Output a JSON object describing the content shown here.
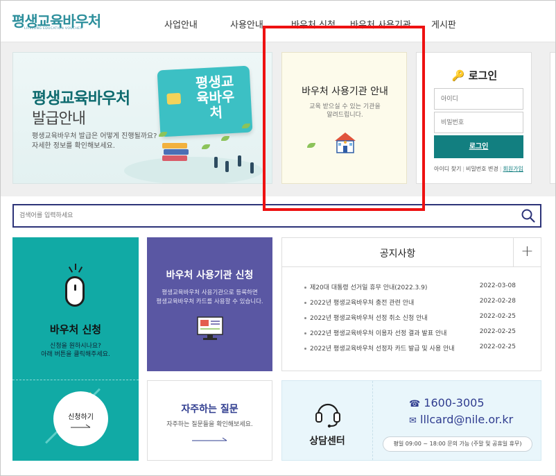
{
  "logo": {
    "main": "평생교육바우처",
    "sub": "LIFELONG EDUCATION VOUCHER"
  },
  "nav": [
    "사업안내",
    "사용안내",
    "바우처 신청",
    "바우처 사용기관",
    "게시판"
  ],
  "banner": {
    "card_text": "평생교육바우처",
    "title": "평생교육바우처",
    "subtitle": "발급안내",
    "desc1": "평생교육바우처 발급은 어떻게 진행될까요?",
    "desc2": "자세한 정보를 확인해보세요."
  },
  "voucher_panel": {
    "title": "바우처 사용기관 안내",
    "desc1": "교육 받으실 수 있는 기관을",
    "desc2": "알려드립니다."
  },
  "login": {
    "title": "로그인",
    "id_placeholder": "아이디",
    "pw_placeholder": "비밀번호",
    "button": "로그인",
    "find_id": "아이디 찾기",
    "change_pw": "비밀번호 변경",
    "join": "회원가입"
  },
  "search": {
    "placeholder": "검색어를 입력하세요"
  },
  "apply_tile": {
    "title": "바우처 신청",
    "desc1": "신청을 원하시나요?",
    "desc2": "아래 버튼을 클릭해주세요.",
    "button": "신청하기"
  },
  "institution_tile": {
    "title": "바우처 사용기관 신청",
    "desc1": "평생교육바우처 사용기관으로 등록하면",
    "desc2": "평생교육바우처 카드를 사용할 수 있습니다."
  },
  "faq": {
    "title": "자주하는 질문",
    "desc": "자주하는 질문들을 확인해보세요."
  },
  "notice": {
    "title": "공지사항",
    "more": "+",
    "items": [
      {
        "title": "제20대 대통령 선거일 휴무 안내(2022.3.9)",
        "date": "2022-03-08"
      },
      {
        "title": "2022년 평생교육바우처 충전 관련 안내",
        "date": "2022-02-28"
      },
      {
        "title": "2022년 평생교육바우처 선정 취소 신청 안내",
        "date": "2022-02-25"
      },
      {
        "title": "2022년 평생교육바우처 이용자 선정 결과 발표 안내",
        "date": "2022-02-25"
      },
      {
        "title": "2022년 평생교육바우처 선정자 카드 발급 및 사용 안내",
        "date": "2022-02-25"
      }
    ]
  },
  "center": {
    "title": "상담센터",
    "phone": "1600-3005",
    "email": "lllcard@nile.or.kr",
    "hours": "평일 09:00 ~ 18:00 문의 가능 (주말 및 공휴일 휴무)"
  },
  "colors": {
    "teal": "#11aaa5",
    "dark_teal": "#127f80",
    "purple": "#5a57a3",
    "navy": "#2f3c8f",
    "highlight": "#ee1111"
  }
}
